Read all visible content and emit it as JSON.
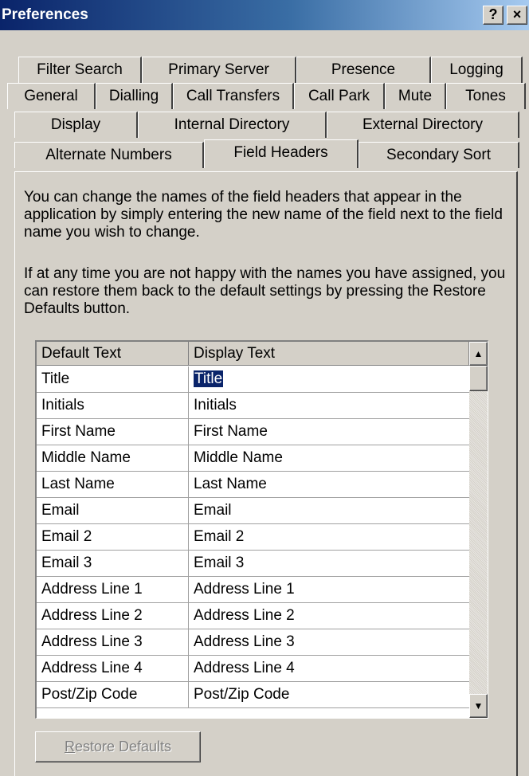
{
  "window": {
    "title": "Preferences",
    "help_label": "?",
    "close_label": "×"
  },
  "tabs": {
    "row1": [
      "Filter Search",
      "Primary Server",
      "Presence",
      "Logging"
    ],
    "row2": [
      "General",
      "Dialling",
      "Call Transfers",
      "Call Park",
      "Mute",
      "Tones"
    ],
    "row3": [
      "Display",
      "Internal Directory",
      "External Directory"
    ],
    "row4": [
      "Alternate Numbers",
      "Field Headers",
      "Secondary Sort"
    ],
    "selected": "Field Headers"
  },
  "description": {
    "para1": "You can change the names of the field headers that appear in the application by simply entering the new name of the field next to the field name you wish to change.",
    "para2": "If at any time you are not happy with the names you have assigned, you can restore them back to the default settings by pressing the Restore Defaults button."
  },
  "grid": {
    "columns": [
      "Default Text",
      "Display Text"
    ],
    "rows": [
      [
        "Title",
        "Title"
      ],
      [
        "Initials",
        "Initials"
      ],
      [
        "First Name",
        "First Name"
      ],
      [
        "Middle Name",
        "Middle Name"
      ],
      [
        "Last Name",
        "Last Name"
      ],
      [
        "Email",
        "Email"
      ],
      [
        "Email 2",
        "Email 2"
      ],
      [
        "Email 3",
        "Email 3"
      ],
      [
        "Address Line 1",
        "Address Line 1"
      ],
      [
        "Address Line 2",
        "Address Line 2"
      ],
      [
        "Address Line 3",
        "Address Line 3"
      ],
      [
        "Address Line 4",
        "Address Line 4"
      ],
      [
        "Post/Zip Code",
        "Post/Zip Code"
      ]
    ],
    "selected_row": 0
  },
  "buttons": {
    "restore_mnemonic": "R",
    "restore_rest": "estore Defaults",
    "restore_enabled": false
  },
  "colors": {
    "title_gradient_start": "#0a246a",
    "title_gradient_end": "#a6caf0",
    "selection": "#0a246a",
    "face": "#d4d0c8"
  }
}
